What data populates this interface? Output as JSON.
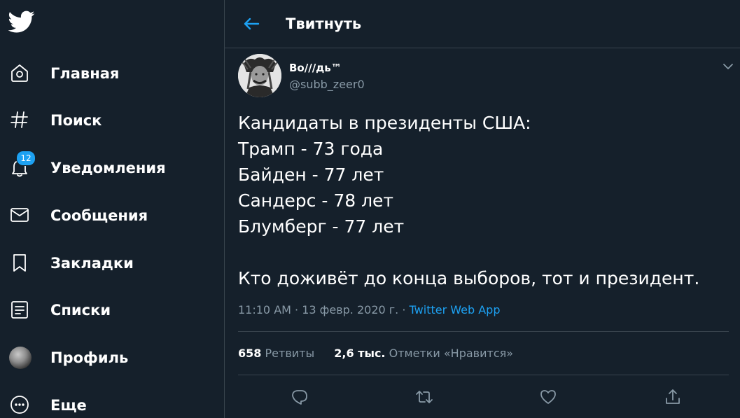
{
  "app": {
    "accent": "#1da1f2",
    "background": "#15202b",
    "muted": "#8899a6"
  },
  "sidebar": {
    "logo_icon": "twitter-bird-icon",
    "items": [
      {
        "label": "Главная",
        "icon": "home-icon"
      },
      {
        "label": "Поиск",
        "icon": "hashtag-icon"
      },
      {
        "label": "Уведомления",
        "icon": "bell-icon",
        "badge": "12"
      },
      {
        "label": "Сообщения",
        "icon": "envelope-icon"
      },
      {
        "label": "Закладки",
        "icon": "bookmark-icon"
      },
      {
        "label": "Списки",
        "icon": "list-icon"
      },
      {
        "label": "Профиль",
        "icon": "avatar"
      },
      {
        "label": "Еще",
        "icon": "more-icon"
      }
    ]
  },
  "header": {
    "back_icon": "arrow-left-icon",
    "title": "Твитнуть"
  },
  "tweet": {
    "author_name": "Во///дь™",
    "author_handle": "@subb_zeer0",
    "lines": [
      "Кандидаты в президенты США:",
      "Трамп - 73 года",
      "Байден - 77 лет",
      "Сандерс - 78 лет",
      "Блумберг - 77 лет",
      "",
      "Кто доживёт до конца выборов, тот и президент."
    ],
    "time": "11:10 AM",
    "date": "13 февр. 2020 г.",
    "meta_separator": "·",
    "source": "Twitter Web App",
    "retweets_count": "658",
    "retweets_label": "Ретвиты",
    "likes_count": "2,6 тыс.",
    "likes_label": "Отметки «Нравится»"
  },
  "actions": [
    {
      "icon": "reply-icon"
    },
    {
      "icon": "retweet-icon"
    },
    {
      "icon": "like-icon"
    },
    {
      "icon": "share-icon"
    }
  ]
}
